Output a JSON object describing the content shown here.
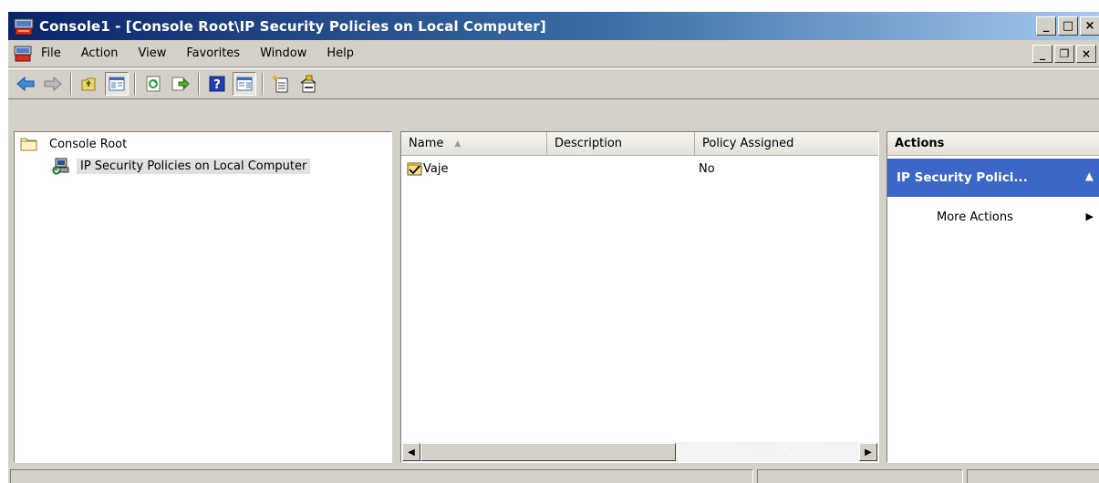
{
  "window": {
    "title": "Console1 - [Console Root\\IP Security Policies on Local Computer]",
    "caption_buttons": {
      "minimize": "_",
      "maximize": "□",
      "close": "×"
    }
  },
  "menubar": {
    "items": [
      "File",
      "Action",
      "View",
      "Favorites",
      "Window",
      "Help"
    ],
    "mdi_buttons": {
      "minimize": "_",
      "restore": "❐",
      "close": "×"
    }
  },
  "toolbar": {
    "icons": [
      "back-icon",
      "forward-icon",
      "up-folder-icon",
      "show-tree-icon",
      "refresh-icon",
      "export-list-icon",
      "help-icon",
      "show-action-pane-icon",
      "new-policy-icon",
      "manage-filters-icon"
    ]
  },
  "tree": {
    "root_label": "Console Root",
    "child_label": "IP Security Policies on Local Computer"
  },
  "list": {
    "columns": [
      "Name",
      "Description",
      "Policy Assigned"
    ],
    "rows": [
      {
        "name": "Vaje",
        "description": "",
        "policy_assigned": "No"
      }
    ]
  },
  "actions": {
    "header": "Actions",
    "group_label": "IP Security Polici...",
    "items": [
      "More Actions"
    ]
  },
  "colors": {
    "titlebar_start": "#0a246a",
    "titlebar_end": "#a6caf0",
    "actions_group": "#3d67c6",
    "chrome": "#d4d0c8"
  }
}
